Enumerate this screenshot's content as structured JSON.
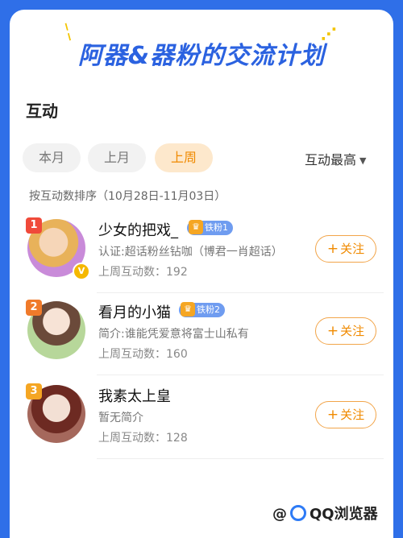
{
  "header": {
    "title": "阿器&器粉的交流计划"
  },
  "section": {
    "title": "互动"
  },
  "tabs": [
    {
      "label": "本月",
      "selected": false
    },
    {
      "label": "上月",
      "selected": false
    },
    {
      "label": "上周",
      "selected": true
    }
  ],
  "sort": {
    "label": "互动最高"
  },
  "subtitle": "按互动数排序（10月28日-11月03日）",
  "users": [
    {
      "rank": "1",
      "name": "少女的把戏_",
      "fan_badge": "铁粉1",
      "desc": "认证:超话粉丝钻咖（博君一肖超话）",
      "count": "上周互动数：192",
      "follow": "关注",
      "verified": true
    },
    {
      "rank": "2",
      "name": "看月的小猫",
      "fan_badge": "铁粉2",
      "desc": "简介:谁能凭爱意将富士山私有",
      "count": "上周互动数：160",
      "follow": "关注",
      "verified": false
    },
    {
      "rank": "3",
      "name": "我素太上皇",
      "fan_badge": "",
      "desc": "暂无简介",
      "count": "上周互动数：128",
      "follow": "关注",
      "verified": false
    }
  ],
  "watermark": {
    "at": "@",
    "text": "QQ浏览器"
  },
  "colors": {
    "background": "#2f6fe8",
    "accent": "#f08a00",
    "title_blue": "#2b62e0"
  }
}
